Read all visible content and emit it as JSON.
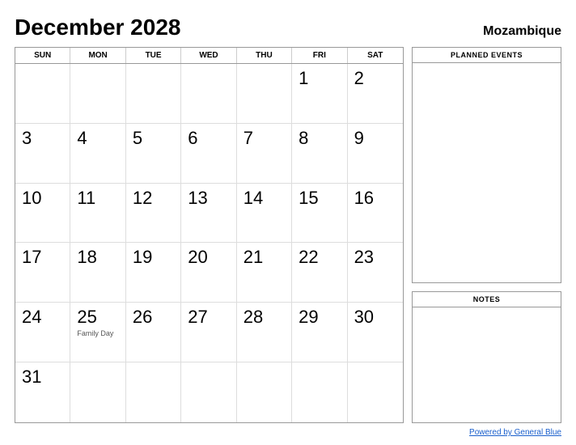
{
  "header": {
    "month_year": "December 2028",
    "country": "Mozambique"
  },
  "day_headers": [
    "SUN",
    "MON",
    "TUE",
    "WED",
    "THU",
    "FRI",
    "SAT"
  ],
  "weeks": [
    [
      {
        "day": "",
        "empty": true
      },
      {
        "day": "",
        "empty": true
      },
      {
        "day": "",
        "empty": true
      },
      {
        "day": "",
        "empty": true
      },
      {
        "day": "",
        "empty": true
      },
      {
        "day": "1",
        "empty": false
      },
      {
        "day": "2",
        "empty": false
      }
    ],
    [
      {
        "day": "3",
        "empty": false
      },
      {
        "day": "4",
        "empty": false
      },
      {
        "day": "5",
        "empty": false
      },
      {
        "day": "6",
        "empty": false
      },
      {
        "day": "7",
        "empty": false
      },
      {
        "day": "8",
        "empty": false
      },
      {
        "day": "9",
        "empty": false
      }
    ],
    [
      {
        "day": "10",
        "empty": false
      },
      {
        "day": "11",
        "empty": false
      },
      {
        "day": "12",
        "empty": false
      },
      {
        "day": "13",
        "empty": false
      },
      {
        "day": "14",
        "empty": false
      },
      {
        "day": "15",
        "empty": false
      },
      {
        "day": "16",
        "empty": false
      }
    ],
    [
      {
        "day": "17",
        "empty": false
      },
      {
        "day": "18",
        "empty": false
      },
      {
        "day": "19",
        "empty": false
      },
      {
        "day": "20",
        "empty": false
      },
      {
        "day": "21",
        "empty": false
      },
      {
        "day": "22",
        "empty": false
      },
      {
        "day": "23",
        "empty": false
      }
    ],
    [
      {
        "day": "24",
        "empty": false
      },
      {
        "day": "25",
        "empty": false,
        "event": "Family Day"
      },
      {
        "day": "26",
        "empty": false
      },
      {
        "day": "27",
        "empty": false
      },
      {
        "day": "28",
        "empty": false
      },
      {
        "day": "29",
        "empty": false
      },
      {
        "day": "30",
        "empty": false
      }
    ],
    [
      {
        "day": "31",
        "empty": false
      },
      {
        "day": "",
        "empty": true
      },
      {
        "day": "",
        "empty": true
      },
      {
        "day": "",
        "empty": true
      },
      {
        "day": "",
        "empty": true
      },
      {
        "day": "",
        "empty": true
      },
      {
        "day": "",
        "empty": true
      }
    ]
  ],
  "sidebar": {
    "planned_events_label": "PLANNED EVENTS",
    "notes_label": "NOTES"
  },
  "footer": {
    "link_text": "Powered by General Blue",
    "link_url": "#"
  }
}
